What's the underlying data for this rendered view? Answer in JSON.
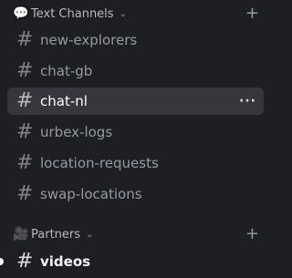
{
  "categories": [
    {
      "emoji": "💬",
      "label": "Text Channels",
      "chevron": "⌄",
      "add": "+"
    },
    {
      "emoji": "🎥",
      "label": "Partners",
      "chevron": "⌄",
      "add": "+"
    }
  ],
  "channels": [
    {
      "hash": "#",
      "label": "new-explorers"
    },
    {
      "hash": "#",
      "label": "chat-gb"
    },
    {
      "hash": "#",
      "label": "chat-nl",
      "active": true,
      "more": "···"
    },
    {
      "hash": "#",
      "label": "urbex-logs"
    },
    {
      "hash": "#",
      "label": "location-requests"
    },
    {
      "hash": "#",
      "label": "swap-locations"
    },
    {
      "hash": "#",
      "label": "videos",
      "unread": true
    }
  ],
  "icons": {
    "category_1": "speech-bubble-icon",
    "category_2": "camera-icon",
    "channel": "hashtag-icon",
    "add": "plus-icon",
    "more": "ellipsis-icon"
  }
}
